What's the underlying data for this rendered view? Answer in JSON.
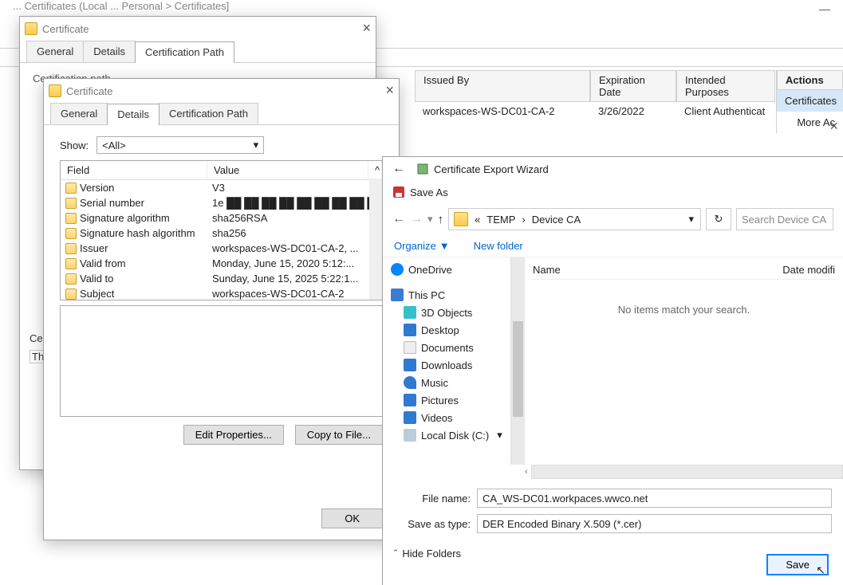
{
  "mmc": {
    "title_fragment": "... Certificates (Local ... Personal > Certificates]",
    "columns": {
      "issued_by": "Issued By",
      "expiration": "Expiration Date",
      "intended": "Intended Purposes"
    },
    "row": {
      "issued_by": "workspaces-WS-DC01-CA-2",
      "expiration": "3/26/2022",
      "intended": "Client Authenticat"
    },
    "actions": {
      "header": "Actions",
      "item1": "Certificates",
      "item2": "More Ac"
    }
  },
  "cert1": {
    "title": "Certificate",
    "tabs": {
      "general": "General",
      "details": "Details",
      "certpath": "Certification Path"
    },
    "section": "Certification path"
  },
  "cert2": {
    "title": "Certificate",
    "tabs": {
      "general": "General",
      "details": "Details",
      "certpath": "Certification Path"
    },
    "show_label": "Show:",
    "show_value": "<All>",
    "columns": {
      "field": "Field",
      "value": "Value"
    },
    "rows": [
      {
        "field": "Version",
        "value": "V3"
      },
      {
        "field": "Serial number",
        "value": "1e  ██ ██ ██ ██ ██ ██ ██ ██ ██"
      },
      {
        "field": "Signature algorithm",
        "value": "sha256RSA"
      },
      {
        "field": "Signature hash algorithm",
        "value": "sha256"
      },
      {
        "field": "Issuer",
        "value": "workspaces-WS-DC01-CA-2, ..."
      },
      {
        "field": "Valid from",
        "value": "Monday, June 15, 2020 5:12:..."
      },
      {
        "field": "Valid to",
        "value": "Sunday, June 15, 2025 5:22:1..."
      },
      {
        "field": "Subject",
        "value": "workspaces-WS-DC01-CA-2"
      }
    ],
    "edit_props": "Edit Properties...",
    "copy_file": "Copy to File...",
    "ok": "OK"
  },
  "left_stub": {
    "c": "Ce",
    "t": "Th"
  },
  "wizard": {
    "title": "Certificate Export Wizard",
    "saveas": "Save As",
    "breadcrumb": {
      "sep": "«",
      "p1": "TEMP",
      "p2": "Device CA"
    },
    "search_placeholder": "Search Device CA",
    "organize": "Organize",
    "new_folder": "New folder",
    "nav": {
      "onedrive": "OneDrive",
      "thispc": "This PC",
      "objects": "3D Objects",
      "desktop": "Desktop",
      "documents": "Documents",
      "downloads": "Downloads",
      "music": "Music",
      "pictures": "Pictures",
      "videos": "Videos",
      "localdisk": "Local Disk (C:)"
    },
    "headers": {
      "name": "Name",
      "date": "Date modifi"
    },
    "empty": "No items match your search.",
    "filename_label": "File name:",
    "filename_value": "CA_WS-DC01.workpaces.wwco.net",
    "savetype_label": "Save as type:",
    "savetype_value": "DER Encoded Binary X.509 (*.cer)",
    "hide_folders": "Hide Folders",
    "save": "Save"
  }
}
